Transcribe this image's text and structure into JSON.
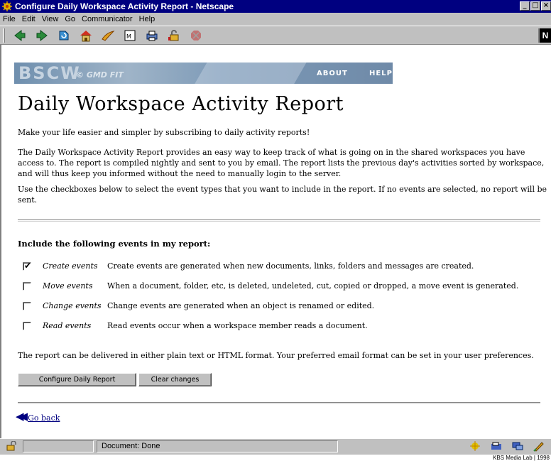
{
  "window": {
    "title": "Configure Daily Workspace Activity Report - Netscape",
    "buttons": [
      "_",
      "□",
      "×"
    ]
  },
  "menubar": {
    "items": [
      {
        "label": "File"
      },
      {
        "label": "Edit"
      },
      {
        "label": "View"
      },
      {
        "label": "Go"
      },
      {
        "label": "Communicator"
      },
      {
        "label": "Help"
      }
    ]
  },
  "toolbar": {
    "icons": [
      "back-icon",
      "forward-icon",
      "reload-icon",
      "home-icon",
      "search-icon",
      "netscape-guide-icon",
      "print-icon",
      "security-icon",
      "stop-icon"
    ],
    "brand": "N"
  },
  "banner": {
    "logo": "BSCW",
    "logo_sub": "© GMD FIT",
    "nav_about": "ABOUT",
    "nav_help": "HELP"
  },
  "page": {
    "title": "Daily Workspace Activity Report",
    "intro": "Make your life easier and simpler by subscribing to daily activity reports!",
    "description": "The Daily Workspace Activity Report provides an easy way to keep track of what is going on in the shared workspaces you have access to. The report is compiled nightly and sent to you by email. The report lists the previous day's activities sorted by workspace, and will thus keep you informed without the need to manually login to the server.",
    "instructions": "Use the checkboxes below to select the event types that you want to include in the report. If no events are selected, no report will be sent.",
    "section_heading": "Include the following events in my report:",
    "events": [
      {
        "name": "Create events",
        "description": "Create events are generated when new documents, links, folders and messages are created.",
        "checked": true
      },
      {
        "name": "Move events",
        "description": "When a document, folder, etc, is deleted, undeleted, cut, copied or dropped, a move event is generated.",
        "checked": false
      },
      {
        "name": "Change events",
        "description": "Change events are generated when an object is renamed or edited.",
        "checked": false
      },
      {
        "name": "Read events",
        "description": "Read events occur when a workspace member reads a document.",
        "checked": false
      }
    ],
    "format_note": "The report can be delivered in either plain text or HTML format. Your preferred email format can be set in your user preferences.",
    "configure_button": "Configure Daily Report",
    "clear_button": "Clear changes",
    "go_back": "Go back"
  },
  "statusbar": {
    "text": "Document: Done"
  },
  "footer": {
    "credit": "KBS Media Lab | 1998"
  }
}
